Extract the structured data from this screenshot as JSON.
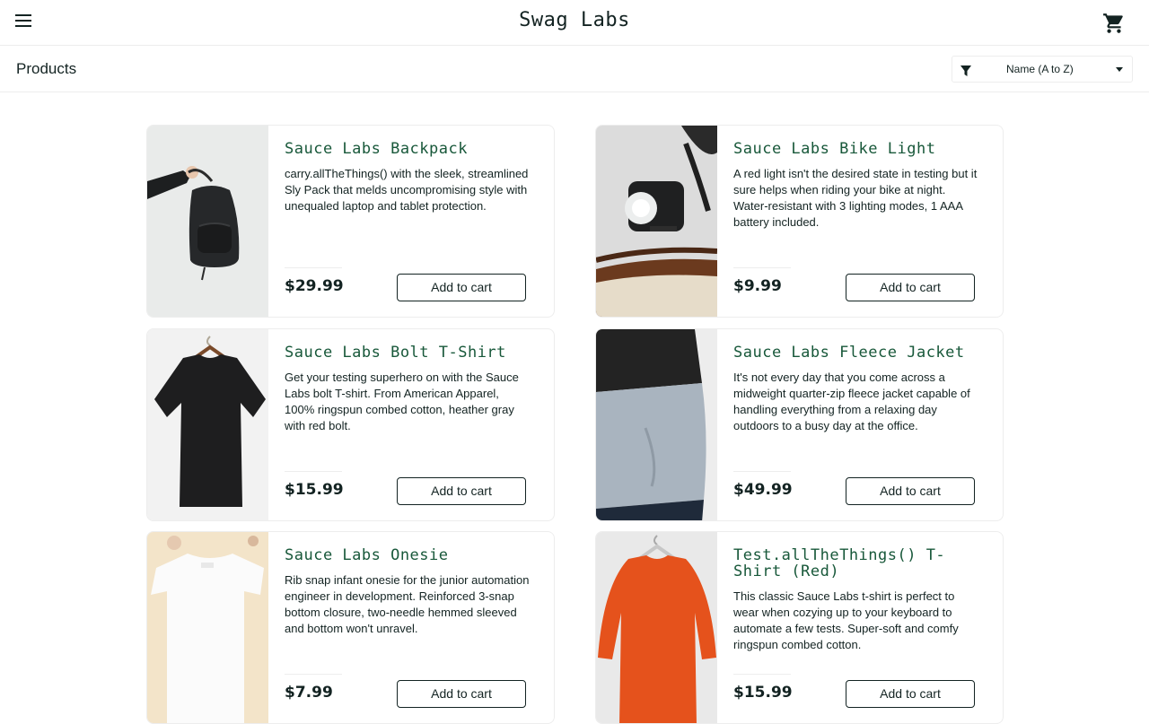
{
  "header": {
    "logo": "Swag Labs",
    "menu_icon": "hamburger-menu-icon",
    "cart_icon": "shopping-cart-icon"
  },
  "subheader": {
    "title": "Products",
    "sort_icon": "filter-icon",
    "sort_selected": "Name (A to Z)"
  },
  "colors": {
    "accent_name": "#18583a",
    "text": "#132322",
    "border": "#ededed"
  },
  "items": [
    {
      "name": "Sauce Labs Backpack",
      "description": "carry.allTheThings() with the sleek, streamlined Sly Pack that melds uncompromising style with unequaled laptop and tablet protection.",
      "price": "$29.99",
      "button": "Add to cart",
      "image": "backpack-image"
    },
    {
      "name": "Sauce Labs Bike Light",
      "description": "A red light isn't the desired state in testing but it sure helps when riding your bike at night. Water-resistant with 3 lighting modes, 1 AAA battery included.",
      "price": "$9.99",
      "button": "Add to cart",
      "image": "bike-light-image"
    },
    {
      "name": "Sauce Labs Bolt T-Shirt",
      "description": "Get your testing superhero on with the Sauce Labs bolt T-shirt. From American Apparel, 100% ringspun combed cotton, heather gray with red bolt.",
      "price": "$15.99",
      "button": "Add to cart",
      "image": "bolt-tshirt-image"
    },
    {
      "name": "Sauce Labs Fleece Jacket",
      "description": "It's not every day that you come across a midweight quarter-zip fleece jacket capable of handling everything from a relaxing day outdoors to a busy day at the office.",
      "price": "$49.99",
      "button": "Add to cart",
      "image": "fleece-jacket-image"
    },
    {
      "name": "Sauce Labs Onesie",
      "description": "Rib snap infant onesie for the junior automation engineer in development. Reinforced 3-snap bottom closure, two-needle hemmed sleeved and bottom won't unravel.",
      "price": "$7.99",
      "button": "Add to cart",
      "image": "onesie-image"
    },
    {
      "name": "Test.allTheThings() T-Shirt (Red)",
      "description": "This classic Sauce Labs t-shirt is perfect to wear when cozying up to your keyboard to automate a few tests. Super-soft and comfy ringspun combed cotton.",
      "price": "$15.99",
      "button": "Add to cart",
      "image": "red-tshirt-image"
    }
  ]
}
